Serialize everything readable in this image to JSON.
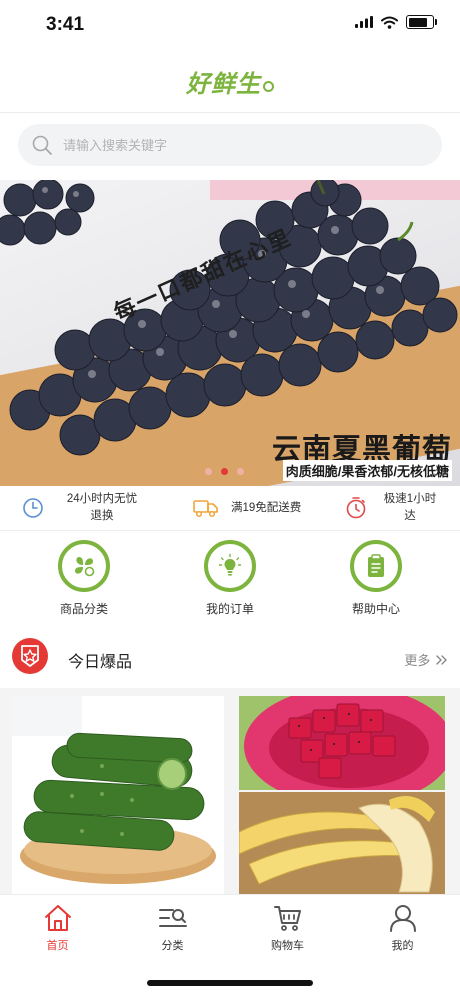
{
  "status": {
    "time": "3:41",
    "battery_level": 0.9
  },
  "header": {
    "logo_text": "好鲜生"
  },
  "search": {
    "placeholder": "请输入搜索关键字"
  },
  "banner": {
    "slogan": "每一口都甜在心里",
    "title": "云南夏黑葡萄",
    "subtitle": "肉质细脆/果香浓郁/无核低糖",
    "slide_count": 3,
    "active_slide": 2
  },
  "features": [
    {
      "icon": "clock-icon",
      "text": "24小时内无忧退换"
    },
    {
      "icon": "delivery-truck-icon",
      "text": "满19免配送费"
    },
    {
      "icon": "stopwatch-icon",
      "text": "极速1小时达"
    }
  ],
  "quick_links": [
    {
      "icon": "category-icon",
      "label": "商品分类"
    },
    {
      "icon": "lightbulb-icon",
      "label": "我的订单"
    },
    {
      "icon": "clipboard-icon",
      "label": "帮助中心"
    }
  ],
  "section": {
    "title": "今日爆品",
    "more_label": "更多"
  },
  "tabbar": [
    {
      "icon": "home-icon",
      "label": "首页",
      "active": true
    },
    {
      "icon": "category-list-icon",
      "label": "分类",
      "active": false
    },
    {
      "icon": "shopping-cart-icon",
      "label": "购物车",
      "active": false
    },
    {
      "icon": "user-icon",
      "label": "我的",
      "active": false
    }
  ],
  "colors": {
    "accent": "#e53935",
    "brand_green": "#7db43e"
  }
}
